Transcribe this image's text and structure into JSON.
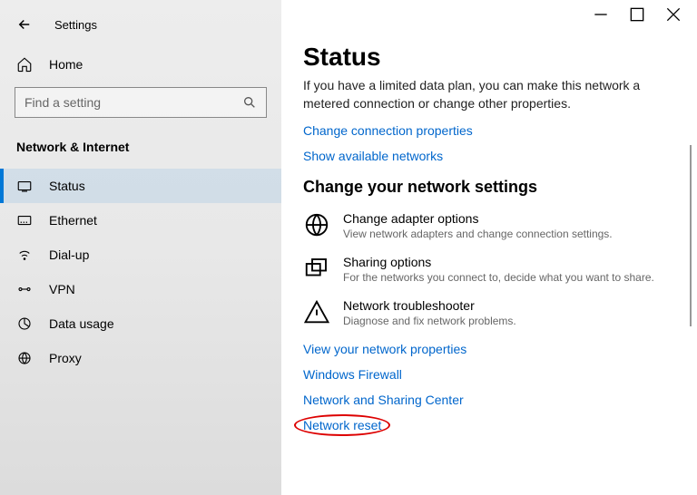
{
  "header": {
    "settings_label": "Settings"
  },
  "sidebar": {
    "home_label": "Home",
    "search_placeholder": "Find a setting",
    "category_title": "Network & Internet",
    "items": [
      {
        "label": "Status",
        "selected": true
      },
      {
        "label": "Ethernet",
        "selected": false
      },
      {
        "label": "Dial-up",
        "selected": false
      },
      {
        "label": "VPN",
        "selected": false
      },
      {
        "label": "Data usage",
        "selected": false
      },
      {
        "label": "Proxy",
        "selected": false
      }
    ]
  },
  "main": {
    "title": "Status",
    "info_text": "If you have a limited data plan, you can make this network a metered connection or change other properties.",
    "link_change_props": "Change connection properties",
    "link_show_networks": "Show available networks",
    "section_title": "Change your network settings",
    "settings": [
      {
        "name": "Change adapter options",
        "desc": "View network adapters and change connection settings."
      },
      {
        "name": "Sharing options",
        "desc": "For the networks you connect to, decide what you want to share."
      },
      {
        "name": "Network troubleshooter",
        "desc": "Diagnose and fix network problems."
      }
    ],
    "link_view_props": "View your network properties",
    "link_firewall": "Windows Firewall",
    "link_sharing_center": "Network and Sharing Center",
    "link_reset": "Network reset"
  }
}
